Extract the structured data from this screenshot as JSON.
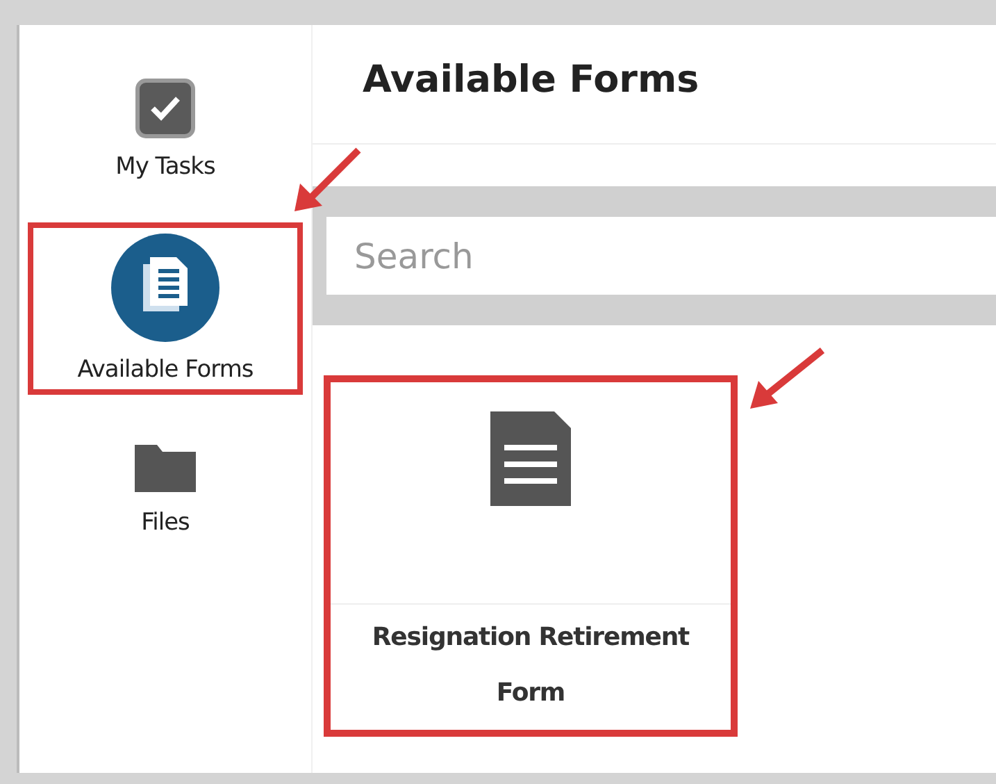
{
  "sidebar": {
    "items": [
      {
        "kind": "tasks",
        "label": "My Tasks",
        "selected": false,
        "annotated": false
      },
      {
        "kind": "forms",
        "label": "Available Forms",
        "selected": true,
        "annotated": true
      },
      {
        "kind": "files",
        "label": "Files",
        "selected": false,
        "annotated": false
      }
    ]
  },
  "page_title": "Available Forms",
  "search": {
    "placeholder": "Search"
  },
  "forms": [
    {
      "title": "Resignation Retirement Form",
      "annotated": true
    }
  ]
}
